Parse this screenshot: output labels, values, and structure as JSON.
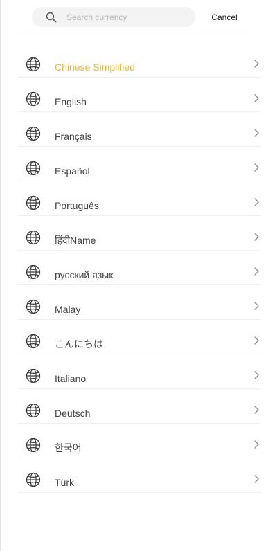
{
  "search": {
    "placeholder": "Search currency",
    "value": "",
    "icon": "search-icon"
  },
  "header": {
    "cancel_label": "Cancel"
  },
  "languages": {
    "selected_index": 0,
    "accent_color": "#efb52e",
    "text_color": "#444444",
    "row_icon": "globe-icon",
    "trailing_icon": "chevron-right-icon",
    "items": [
      {
        "label": "Chinese Simplified"
      },
      {
        "label": "English"
      },
      {
        "label": "Français"
      },
      {
        "label": "Español"
      },
      {
        "label": "Português"
      },
      {
        "label": "हिंदीName"
      },
      {
        "label": "русский язык"
      },
      {
        "label": "Malay"
      },
      {
        "label": "こんにちは"
      },
      {
        "label": "Italiano"
      },
      {
        "label": "Deutsch"
      },
      {
        "label": "한국어"
      },
      {
        "label": "Türk"
      }
    ]
  }
}
